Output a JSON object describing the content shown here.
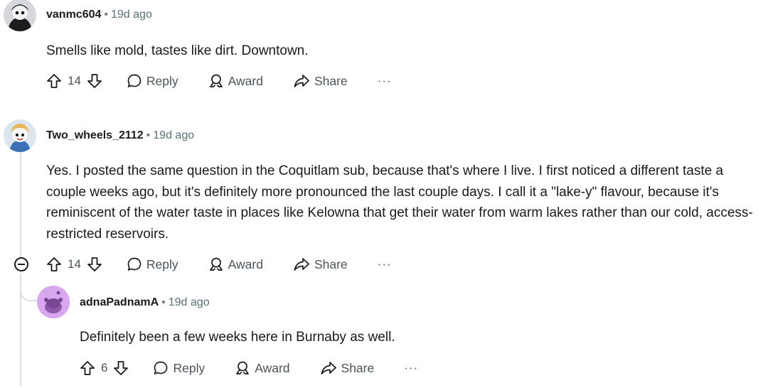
{
  "comments": [
    {
      "username": "vanmc604",
      "time": "19d ago",
      "text": "Smells like mold, tastes like dirt. Downtown.",
      "score": "14",
      "reply_label": "Reply",
      "award_label": "Award",
      "share_label": "Share",
      "more_label": "···"
    },
    {
      "username": "Two_wheels_2112",
      "time": "19d ago",
      "text": "Yes. I posted the same question in the Coquitlam sub, because that's where I live. I first noticed a different taste a couple weeks ago, but it's definitely more pronounced the last couple days. I call it a \"lake-y\" flavour, because it's reminiscent of the water taste in places like Kelowna that get their water from warm lakes rather than our cold, access-restricted reservoirs.",
      "score": "14",
      "reply_label": "Reply",
      "award_label": "Award",
      "share_label": "Share",
      "more_label": "···"
    },
    {
      "username": "adnaPadnamA",
      "time": "19d ago",
      "text": "Definitely been a few weeks here in Burnaby as well.",
      "score": "6",
      "reply_label": "Reply",
      "award_label": "Award",
      "share_label": "Share",
      "more_label": "···"
    }
  ],
  "separator": "•",
  "colors": {
    "text": "#1a1a1b",
    "meta": "#576f76",
    "actions": "#4a545c",
    "thread_line": "#dcdfe2",
    "reply_avatar_bg": "#d9a7f0"
  }
}
